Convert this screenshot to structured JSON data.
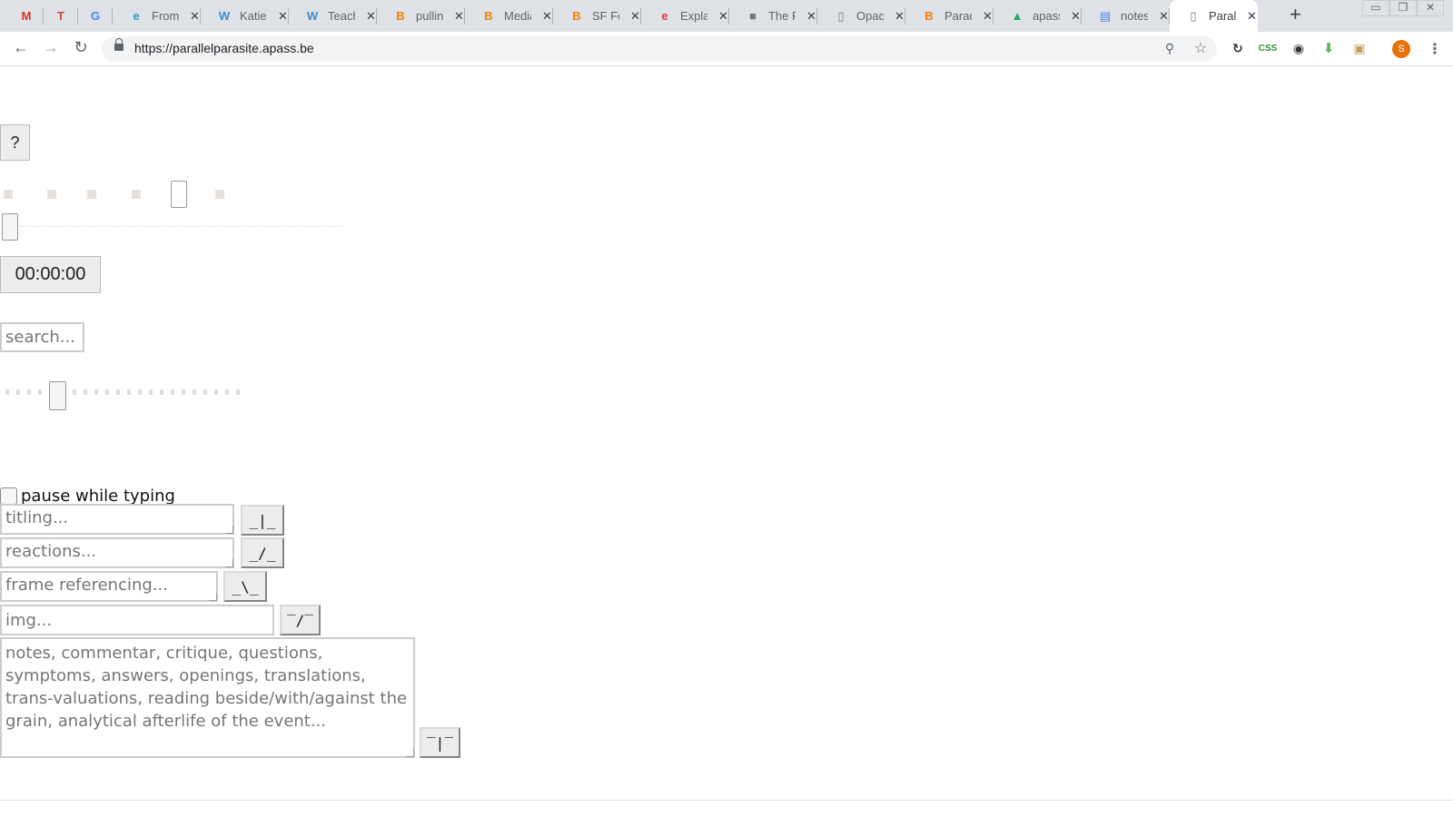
{
  "browser": {
    "tabs": [
      {
        "title": "",
        "icon": "gmail-icon",
        "icon_glyph": "M",
        "icon_color": "#d93025"
      },
      {
        "title": "",
        "icon": "todoist-icon",
        "icon_glyph": "T",
        "icon_color": "#db4035"
      },
      {
        "title": "",
        "icon": "translate-icon",
        "icon_glyph": "G",
        "icon_color": "#4285f4"
      },
      {
        "title": "From",
        "icon": "edge-icon",
        "icon_glyph": "e",
        "icon_color": "#2e9ad0"
      },
      {
        "title": "Katie",
        "icon": "wordpress-icon",
        "icon_glyph": "W",
        "icon_color": "#3b8ed0"
      },
      {
        "title": "Teach",
        "icon": "wordpress-icon",
        "icon_glyph": "W",
        "icon_color": "#3b8ed0"
      },
      {
        "title": "pullin",
        "icon": "blogger-icon",
        "icon_glyph": "B",
        "icon_color": "#f57d00"
      },
      {
        "title": "Media",
        "icon": "blogger-icon",
        "icon_glyph": "B",
        "icon_color": "#f57d00"
      },
      {
        "title": "SF Fer",
        "icon": "blogger-icon",
        "icon_glyph": "B",
        "icon_color": "#f57d00"
      },
      {
        "title": "Explai",
        "icon": "e-icon",
        "icon_glyph": "e",
        "icon_color": "#e53935"
      },
      {
        "title": "The P",
        "icon": "cube-icon",
        "icon_glyph": "■",
        "icon_color": "#777777"
      },
      {
        "title": "Opaq",
        "icon": "page-icon",
        "icon_glyph": "▯",
        "icon_color": "#777777"
      },
      {
        "title": "Parad",
        "icon": "blogger-icon",
        "icon_glyph": "B",
        "icon_color": "#f57d00"
      },
      {
        "title": "apass",
        "icon": "drive-icon",
        "icon_glyph": "▲",
        "icon_color": "#1fa463"
      },
      {
        "title": "notes",
        "icon": "docs-icon",
        "icon_glyph": "▤",
        "icon_color": "#4285f4"
      },
      {
        "title": "Parall",
        "icon": "page-icon",
        "icon_glyph": "▯",
        "icon_color": "#777777",
        "active": true
      }
    ],
    "url": "https://parallelparasite.apass.be",
    "profile_initial": "S",
    "ext_css_label": "CSS"
  },
  "page": {
    "help_label": "?",
    "timecode": "00:00:00",
    "search_placeholder": "search...",
    "pause_label": "pause while typing",
    "pause_checked": false,
    "fields": {
      "titling_placeholder": "titling...",
      "titling_button": "_|_",
      "reactions_placeholder": "reactions...",
      "reactions_button": "_/_",
      "frame_placeholder": "frame referencing...",
      "frame_button": "_\\_",
      "img_placeholder": "img...",
      "img_button": "‾/‾",
      "notes_placeholder": "notes, commentar, critique, questions, symptoms, answers, openings, translations, trans-valuations, reading beside/with/against the grain, analytical afterlife of the event...",
      "notes_button": "‾|‾"
    }
  }
}
